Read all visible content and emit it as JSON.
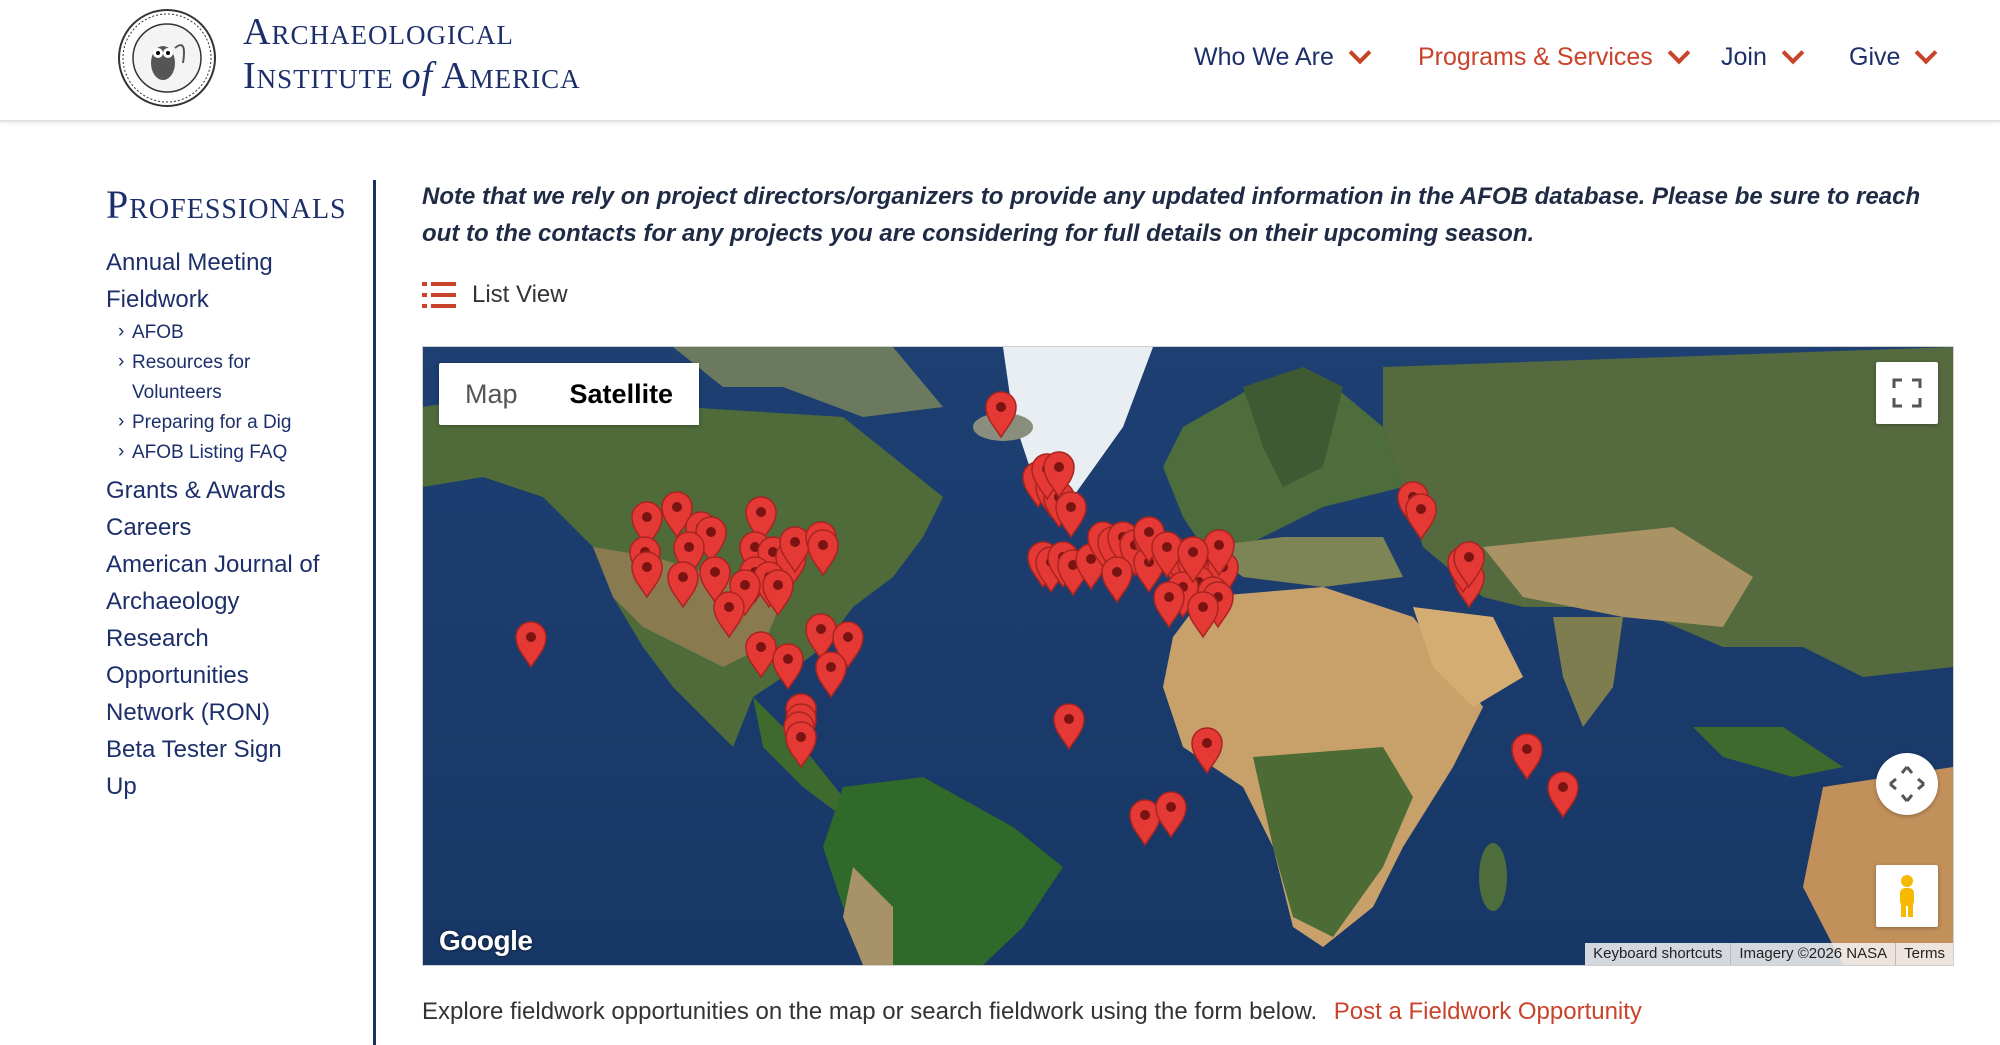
{
  "header": {
    "logo_line1": "Archaeological",
    "logo_line2a": "Institute",
    "logo_line2b": "of",
    "logo_line2c": "America",
    "nav": [
      {
        "label": "Who We Are"
      },
      {
        "label": "Programs & Services"
      },
      {
        "label": "Join"
      },
      {
        "label": "Give"
      }
    ]
  },
  "sidebar": {
    "title": "Professionals",
    "items": [
      {
        "label": "Annual Meeting"
      },
      {
        "label": "Fieldwork"
      },
      {
        "label": "AFOB"
      },
      {
        "label": "Resources for Volunteers"
      },
      {
        "label": "Preparing for a Dig"
      },
      {
        "label": "AFOB Listing FAQ"
      },
      {
        "label": "Grants & Awards"
      },
      {
        "label": "Careers"
      },
      {
        "label": "American Journal of Archaeology"
      },
      {
        "label": "Research Opportunities Network (RON)"
      },
      {
        "label": "Beta Tester Sign Up"
      }
    ]
  },
  "main": {
    "note": "Note that we rely on project directors/organizers to provide any updated information in the AFOB database. Please be sure to reach out to the contacts for any projects you are considering for full details on their upcoming season.",
    "list_view_label": "List View",
    "map": {
      "type_buttons": [
        "Map",
        "Satellite"
      ],
      "active_type": "Satellite",
      "google_label": "Google",
      "attribution": [
        "Keyboard shortcuts",
        "Imagery ©2026 NASA",
        "Terms"
      ]
    },
    "explore_text": "Explore fieldwork opportunities on the map or search fieldwork using the form below.",
    "post_link": "Post a Fieldwork Opportunity"
  },
  "colors": {
    "brand_navy": "#1d2f6b",
    "accent_red": "#c9432b",
    "marker_red": "#e53935"
  },
  "icons": [
    "owl-seal-logo",
    "chevron-down-icon",
    "list-icon",
    "fullscreen-icon",
    "pan-icon",
    "pegman-icon",
    "map-marker-icon"
  ]
}
